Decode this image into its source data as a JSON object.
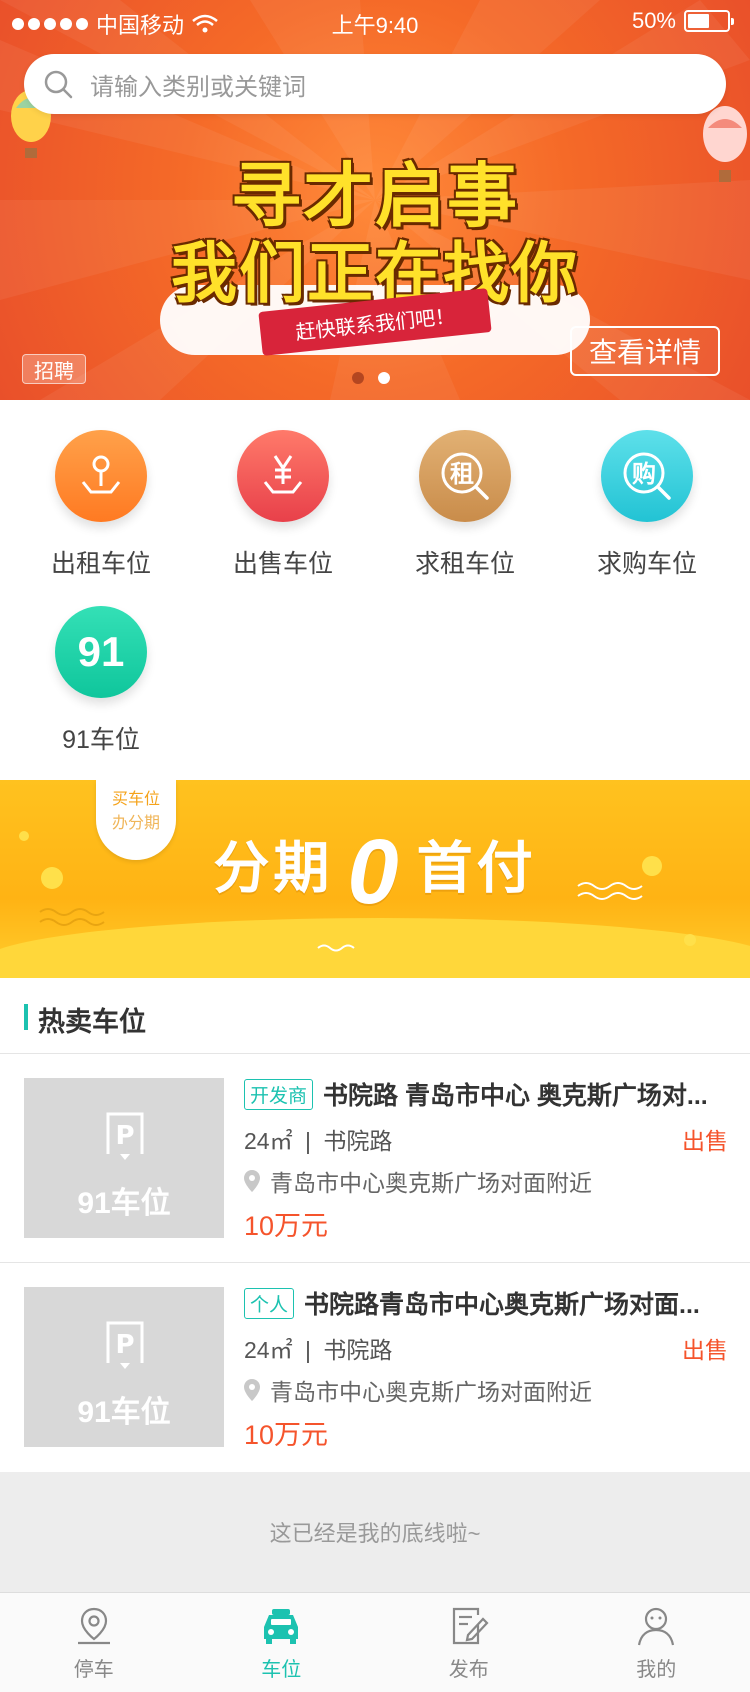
{
  "status_bar": {
    "carrier": "中国移动",
    "time": "上午9:40",
    "battery": "50%"
  },
  "search": {
    "placeholder": "请输入类别或关键词"
  },
  "banner": {
    "headline1": "寻才启事",
    "headline2": "我们正在找你",
    "ribbon": "赶快联系我们吧！",
    "badge": "招聘",
    "detail_button": "查看详情",
    "pages": 2,
    "active_page": 2
  },
  "categories": [
    {
      "label": "出租车位",
      "icon": "map-pin-icon",
      "color": "#ff8a2c"
    },
    {
      "label": "出售车位",
      "icon": "yen-icon",
      "color": "#f2535a"
    },
    {
      "label": "求租车位",
      "icon": "rent-search-icon",
      "color": "#d6a060"
    },
    {
      "label": "求购车位",
      "icon": "buy-search-icon",
      "color": "#2fd0de"
    },
    {
      "label": "91车位",
      "icon": "91-logo-icon",
      "color": "#19d3a8",
      "glyph": "91"
    }
  ],
  "promo": {
    "tag_line1": "买车位",
    "tag_line2": "办分期",
    "slogan_left": "分期",
    "slogan_zero": "0",
    "slogan_right": "首付"
  },
  "section": {
    "title": "热卖车位"
  },
  "listings": [
    {
      "chip": "开发商",
      "name": "书院路 青岛市中心 奥克斯广场对...",
      "area": "24㎡",
      "separator": "|",
      "road": "书院路",
      "type": "出售",
      "address": "青岛市中心奥克斯广场对面附近",
      "price": "10万元",
      "thumb_text": "91车位"
    },
    {
      "chip": "个人",
      "name": "书院路青岛市中心奥克斯广场对面...",
      "area": "24㎡",
      "separator": "|",
      "road": "书院路",
      "type": "出售",
      "address": "青岛市中心奥克斯广场对面附近",
      "price": "10万元",
      "thumb_text": "91车位"
    }
  ],
  "end_note": "这已经是我的底线啦~",
  "tabbar": [
    {
      "label": "停车",
      "icon": "location-pin-icon",
      "active": false
    },
    {
      "label": "车位",
      "icon": "car-icon",
      "active": true
    },
    {
      "label": "发布",
      "icon": "edit-document-icon",
      "active": false
    },
    {
      "label": "我的",
      "icon": "profile-icon",
      "active": false
    }
  ],
  "colors": {
    "accent": "#1cc2b0",
    "price": "#f5542c",
    "banner": "#f56a28",
    "promo": "#ffb314"
  }
}
